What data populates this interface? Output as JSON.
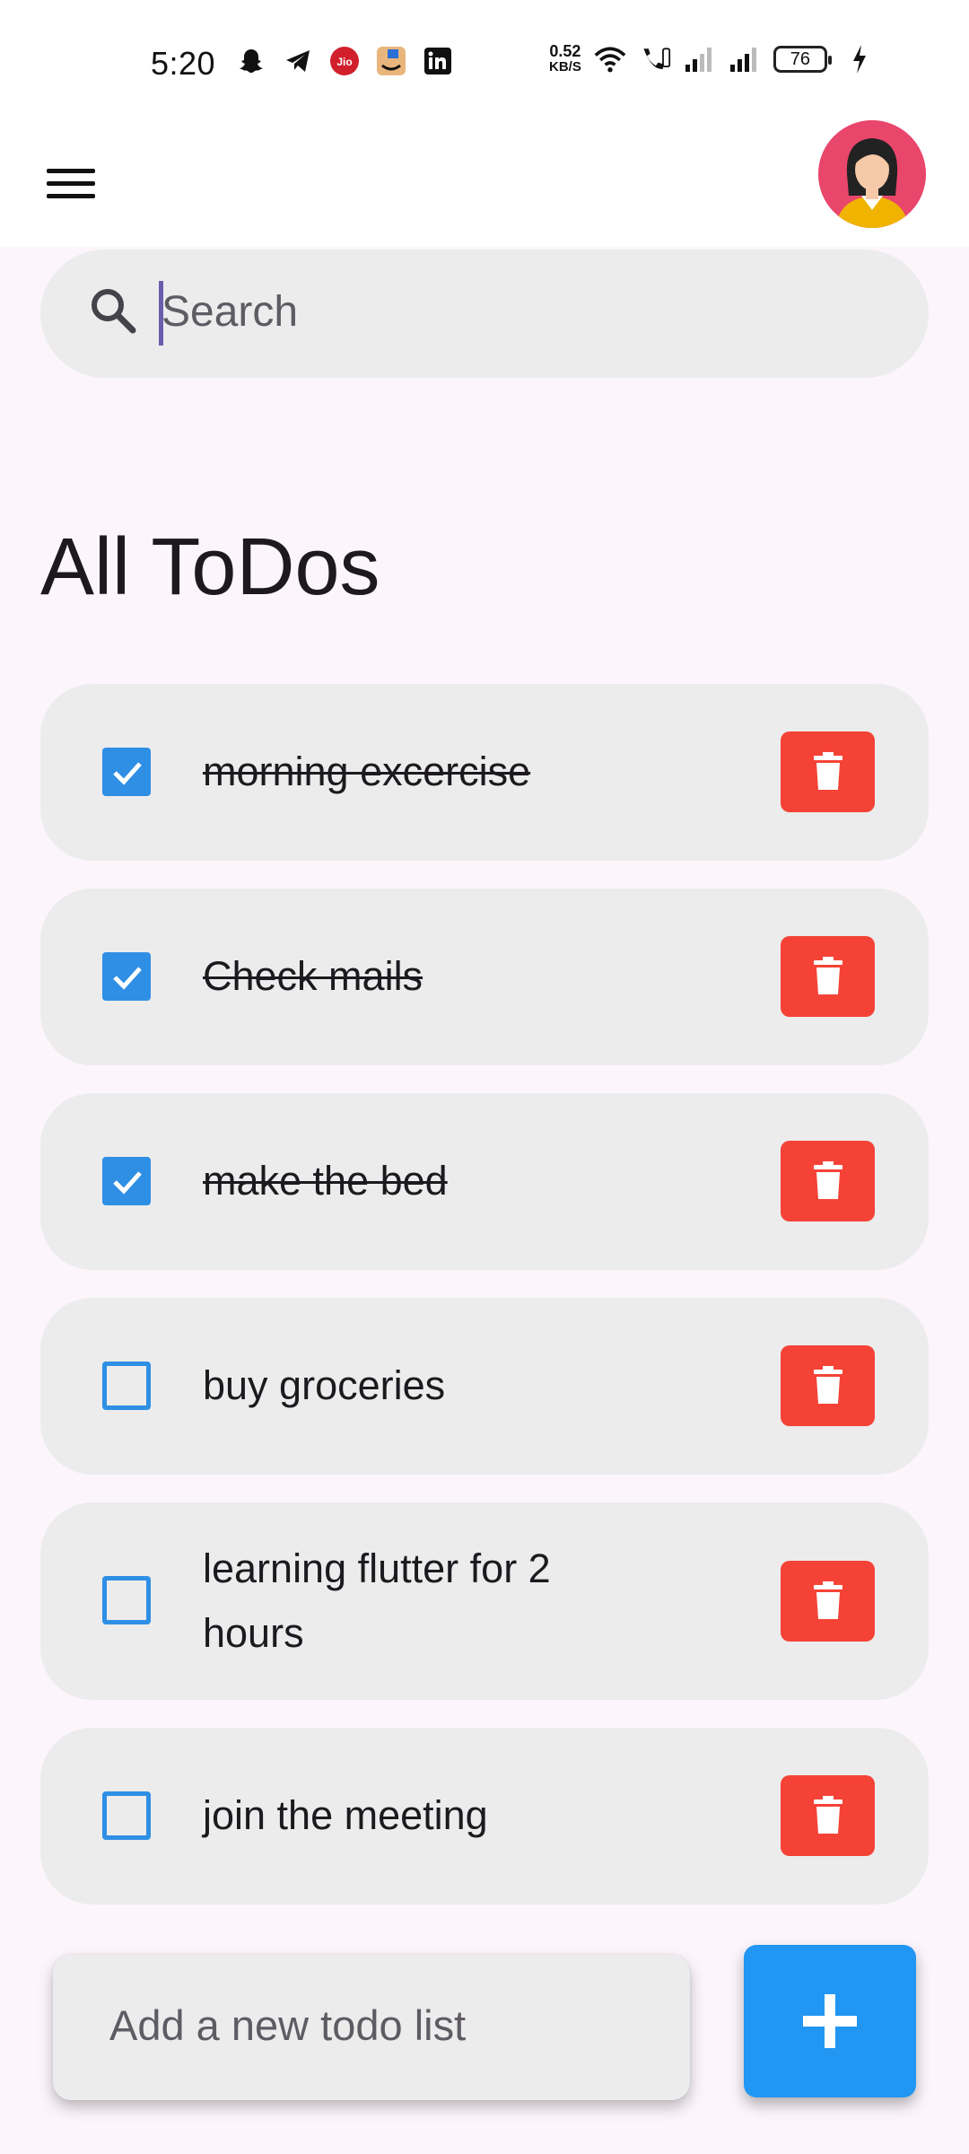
{
  "status_bar": {
    "time": "5:20",
    "net_speed_value": "0.52",
    "net_speed_unit": "KB/S",
    "battery": "76",
    "left_icons": [
      "snapchat-icon",
      "telegram-icon",
      "jio-icon",
      "amazon-icon",
      "linkedin-icon"
    ],
    "right_icons": [
      "wifi-icon",
      "wifi-call-icon",
      "signal-1-icon",
      "signal-2-icon",
      "charging-icon"
    ]
  },
  "app_bar": {
    "menu_icon": "hamburger-menu-icon",
    "avatar": "user-avatar"
  },
  "search": {
    "placeholder": "Search"
  },
  "title": "All ToDos",
  "todos": [
    {
      "label": "morning excercise",
      "done": true
    },
    {
      "label": "Check mails",
      "done": true
    },
    {
      "label": "make the bed",
      "done": true
    },
    {
      "label": "buy groceries",
      "done": false
    },
    {
      "label": "learning flutter for 2",
      "label_line2": "hours",
      "done": false
    },
    {
      "label": "join the meeting",
      "done": false
    }
  ],
  "add_todo": {
    "placeholder": "Add a new todo list",
    "button_icon": "plus-icon"
  },
  "colors": {
    "accent": "#2196f3",
    "delete": "#f44336",
    "card": "#ececec",
    "background": "#fcf6fc"
  }
}
